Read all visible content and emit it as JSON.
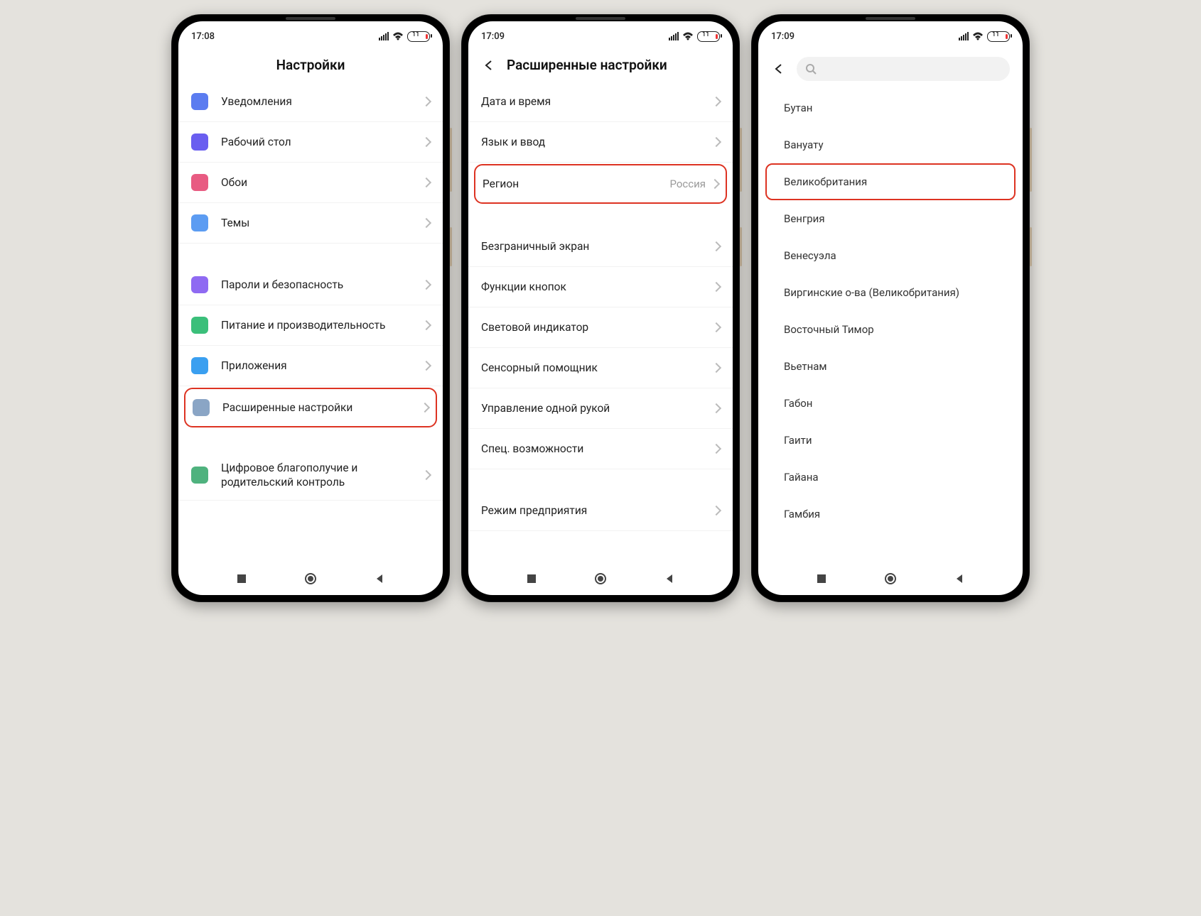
{
  "status": {
    "time1": "17:08",
    "time2": "17:09",
    "time3": "17:09",
    "battery": "11"
  },
  "screen1": {
    "title": "Настройки",
    "rows": [
      {
        "label": "Уведомления",
        "icon": "#5b7cf0"
      },
      {
        "label": "Рабочий стол",
        "icon": "#6a5ef0"
      },
      {
        "label": "Обои",
        "icon": "#e85b82"
      },
      {
        "label": "Темы",
        "icon": "#5c9cf2"
      }
    ],
    "rows2": [
      {
        "label": "Пароли и безопасность",
        "icon": "#8f6af2"
      },
      {
        "label": "Питание и производительность",
        "icon": "#3bbf7a"
      },
      {
        "label": "Приложения",
        "icon": "#3a9ff0"
      },
      {
        "label": "Расширенные настройки",
        "icon": "#8aa5c5",
        "hl": true
      }
    ],
    "rows3": [
      {
        "label": "Цифровое благополучие и родительский контроль",
        "icon": "#4fb27e"
      }
    ]
  },
  "screen2": {
    "title": "Расширенные настройки",
    "g1": [
      {
        "label": "Дата и время"
      },
      {
        "label": "Язык и ввод"
      },
      {
        "label": "Регион",
        "value": "Россия",
        "hl": true
      }
    ],
    "g2": [
      {
        "label": "Безграничный экран"
      },
      {
        "label": "Функции кнопок"
      },
      {
        "label": "Световой индикатор"
      },
      {
        "label": "Сенсорный помощник"
      },
      {
        "label": "Управление одной рукой"
      },
      {
        "label": "Спец. возможности"
      }
    ],
    "g3": [
      {
        "label": "Режим предприятия"
      }
    ]
  },
  "screen3": {
    "items": [
      "Бутан",
      "Вануату",
      "Великобритания",
      "Венгрия",
      "Венесуэла",
      "Виргинские о-ва (Великобритания)",
      "Восточный Тимор",
      "Вьетнам",
      "Габон",
      "Гаити",
      "Гайана",
      "Гамбия"
    ],
    "hl_index": 2
  }
}
